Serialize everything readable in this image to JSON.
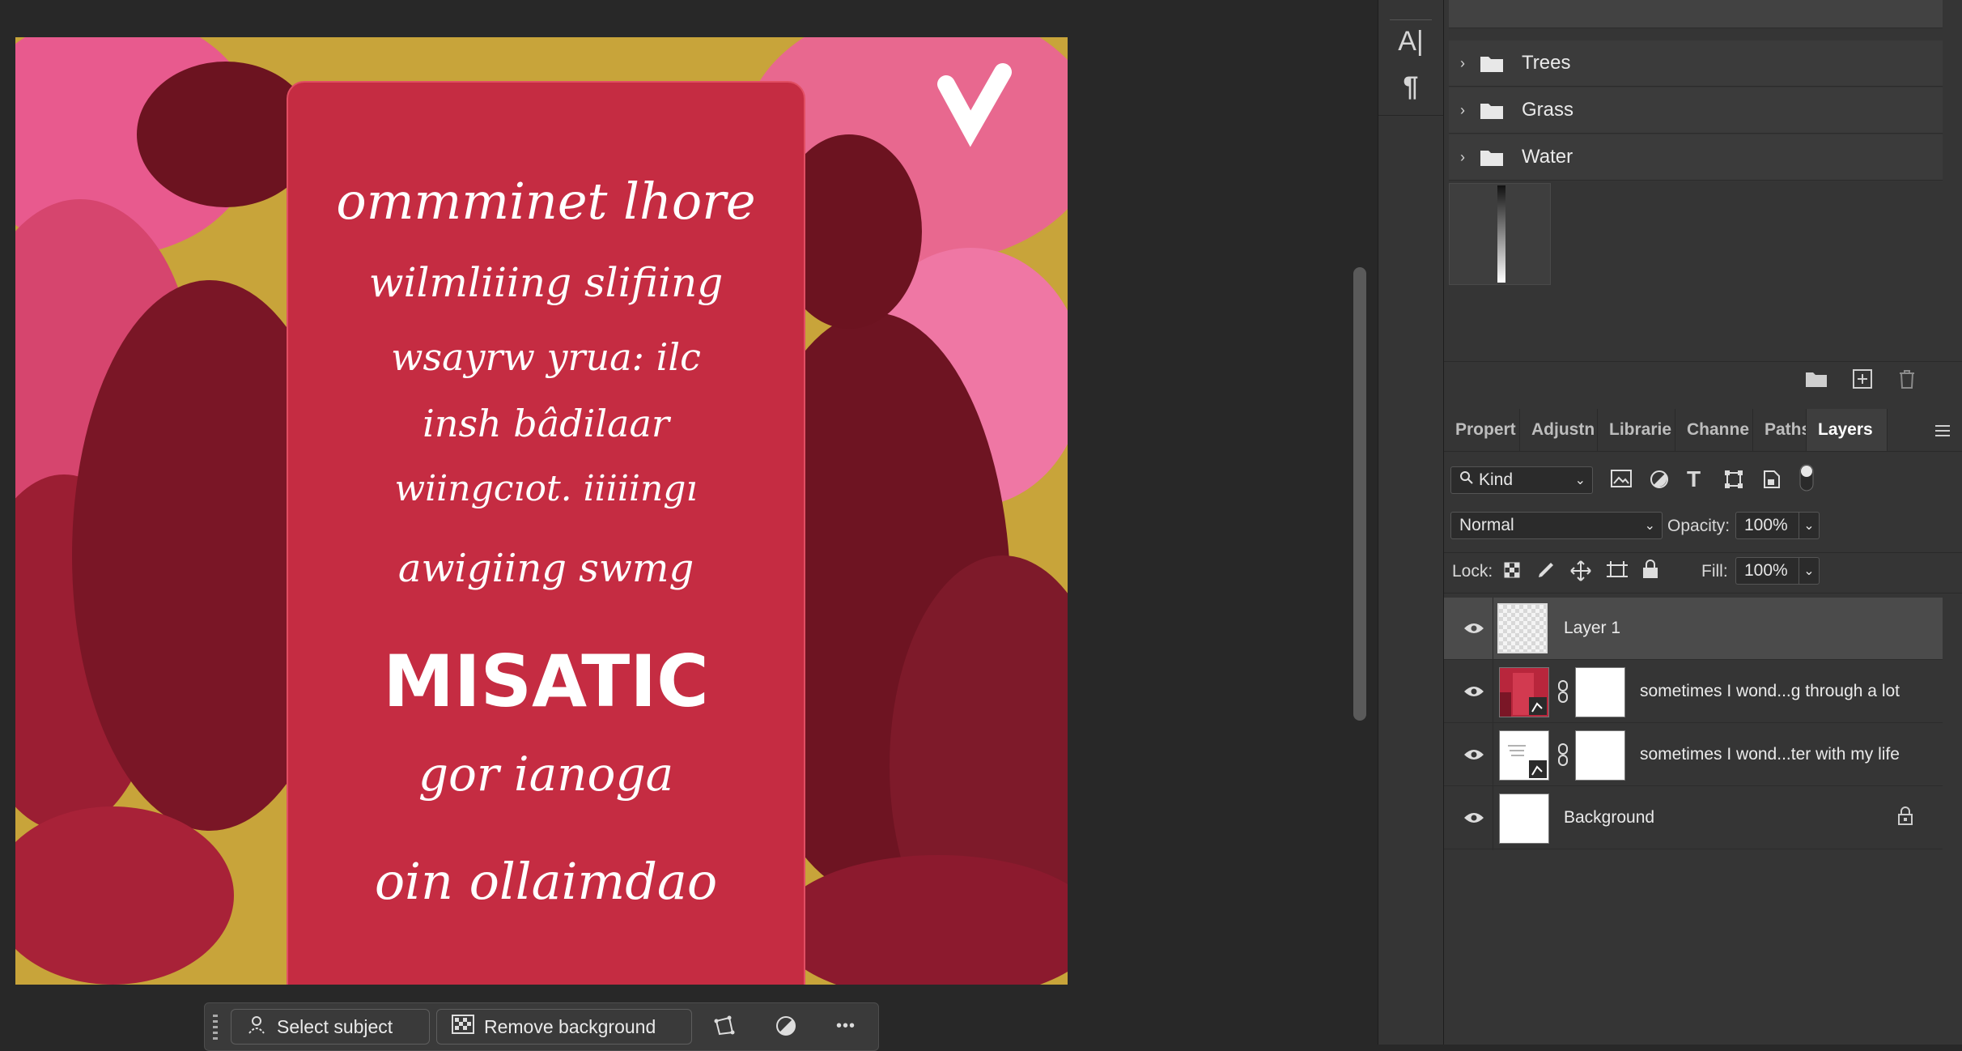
{
  "canvas": {
    "art_lines": [
      "ommminet lhore",
      "wilmliiing slifiing",
      "wsayrw yrua: ilc",
      "insh bâdilaar",
      "wiingcıot. iiiiingı",
      "awigiing swmg",
      "MISATIC",
      "gor ianoga",
      "oin ollaimdao"
    ]
  },
  "taskbar": {
    "select_subject": "Select subject",
    "remove_background": "Remove background",
    "more": "•••"
  },
  "tools": {
    "character_icon": "A|",
    "paragraph_icon": "¶"
  },
  "groups": [
    {
      "label": "Trees"
    },
    {
      "label": "Grass"
    },
    {
      "label": "Water"
    }
  ],
  "tabs": [
    "Propert",
    "Adjustn",
    "Librarie",
    "Channe",
    "Paths",
    "Layers"
  ],
  "active_tab": "Layers",
  "filter": {
    "kind": "Kind"
  },
  "blend": {
    "mode": "Normal",
    "opacity_label": "Opacity:",
    "opacity_value": "100%",
    "lock_label": "Lock:",
    "fill_label": "Fill:",
    "fill_value": "100%"
  },
  "layers": [
    {
      "name": "Layer 1",
      "selected": true
    },
    {
      "name": "sometimes I wond...g through a lot",
      "selected": false
    },
    {
      "name": "sometimes I wond...ter with my life",
      "selected": false
    },
    {
      "name": "Background",
      "selected": false,
      "locked": true
    }
  ],
  "colors": {
    "panel_bg": "#353535",
    "selected_row": "#4b4b4b",
    "card_red": "#c52c42"
  }
}
